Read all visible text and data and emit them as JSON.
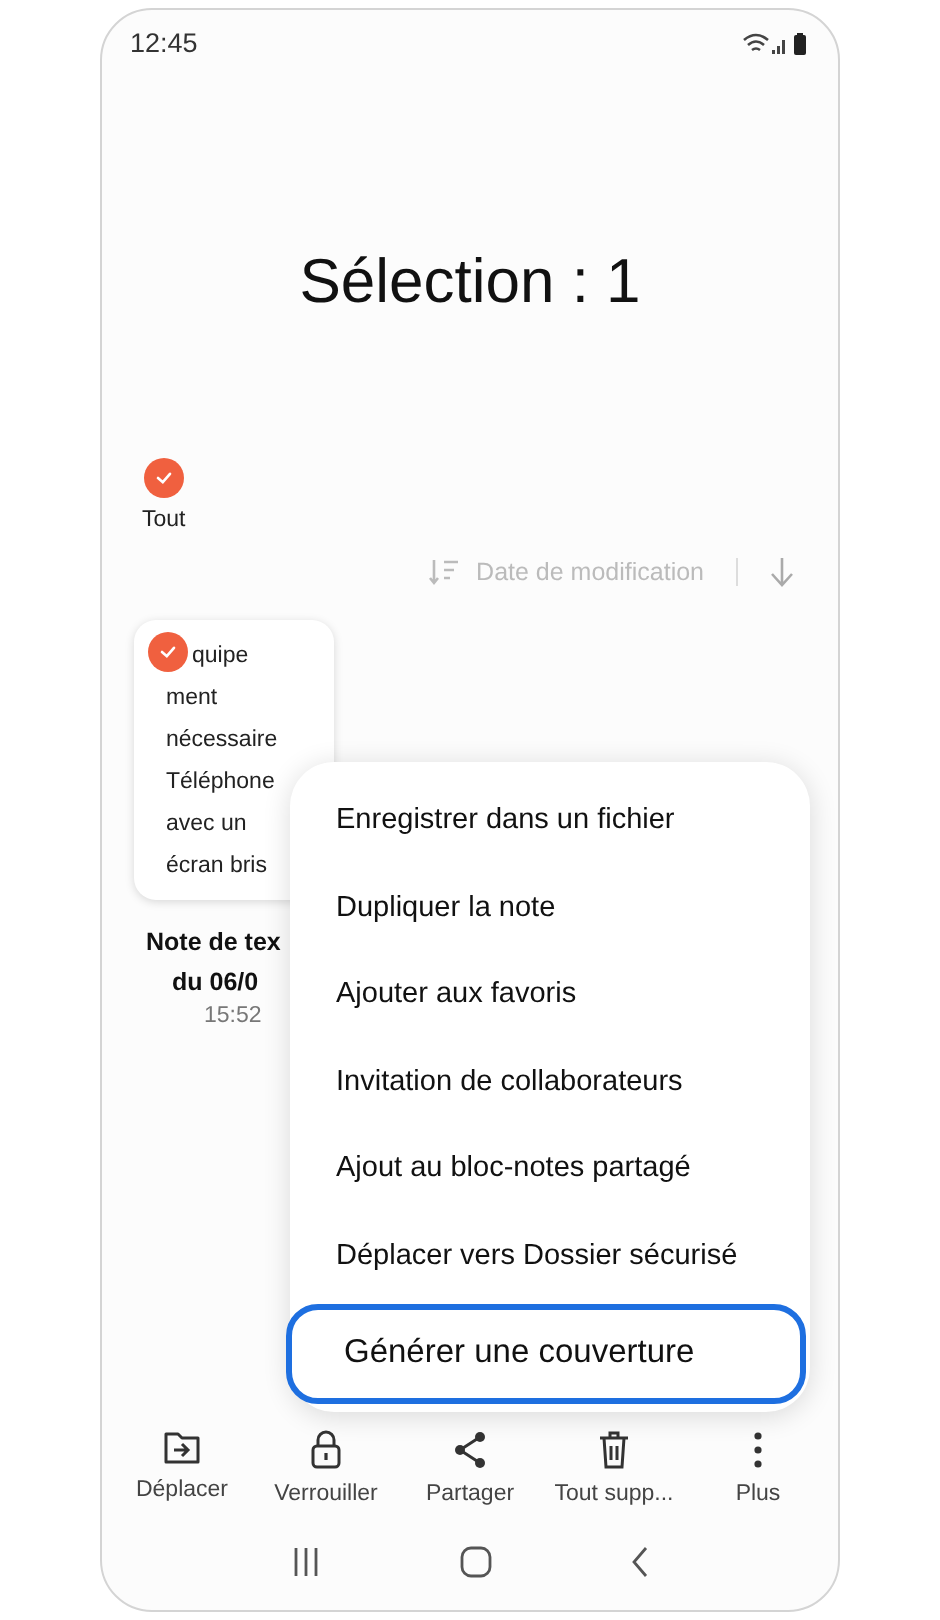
{
  "status_bar": {
    "time": "12:45"
  },
  "title": "Sélection : 1",
  "select_all": {
    "label": "Tout",
    "checked": true
  },
  "sort": {
    "label": "Date de modification"
  },
  "notes": [
    {
      "checked": true,
      "preview_lines": [
        "quipe",
        "ment",
        "nécessaire",
        "Téléphone",
        "avec un",
        "écran bris"
      ],
      "title_lines": [
        "Note de tex",
        "du 06/0"
      ],
      "time": "15:52"
    }
  ],
  "menu": [
    {
      "label": "Enregistrer dans un fichier",
      "selected": false
    },
    {
      "label": "Dupliquer la note",
      "selected": false
    },
    {
      "label": "Ajouter aux favoris",
      "selected": false
    },
    {
      "label": "Invitation de collaborateurs",
      "selected": false
    },
    {
      "label": "Ajout au bloc-notes partagé",
      "selected": false
    },
    {
      "label": "Déplacer vers Dossier sécurisé",
      "selected": false
    },
    {
      "label": "Générer une couverture",
      "selected": true
    }
  ],
  "actions": [
    {
      "kind": "move",
      "label": "Déplacer"
    },
    {
      "kind": "lock",
      "label": "Verrouiller"
    },
    {
      "kind": "share",
      "label": "Partager"
    },
    {
      "kind": "delete",
      "label": "Tout supp..."
    },
    {
      "kind": "more",
      "label": "Plus"
    }
  ]
}
